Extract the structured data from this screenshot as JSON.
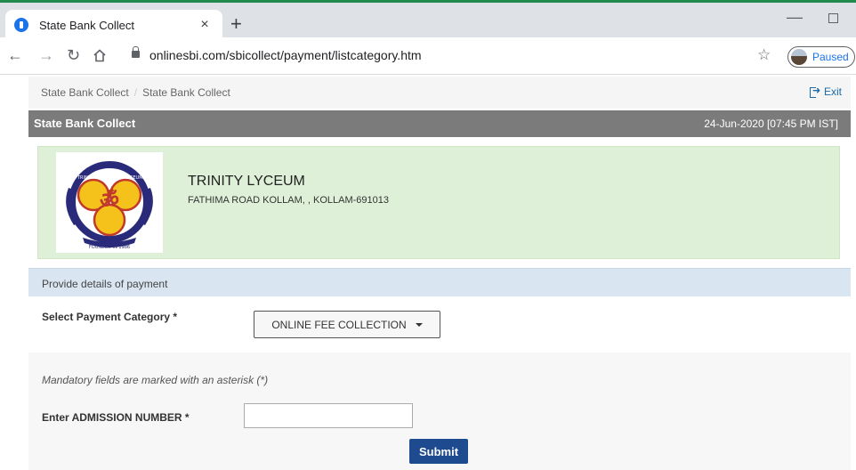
{
  "browser": {
    "tab_title": "State Bank Collect",
    "tab_close": "×",
    "new_tab": "+",
    "url": "onlinesbi.com/sbicollect/payment/listcategory.htm",
    "profile_label": "Paused",
    "window_minimize": "—"
  },
  "breadcrumb": {
    "items": [
      "State Bank Collect",
      "State Bank Collect"
    ],
    "separator": "/"
  },
  "exit_label": "Exit",
  "title_bar": {
    "title": "State Bank Collect",
    "datetime": "24-Jun-2020 [07:45 PM IST]"
  },
  "institution": {
    "name": "TRINITY LYCEUM",
    "address": "FATHIMA ROAD KOLLAM, , KOLLAM-691013",
    "logo_text": [
      "QUILON",
      "TRINITY",
      "LYCEUM",
      "FOUNDED IN 1986"
    ]
  },
  "section": {
    "header": "Provide details of payment"
  },
  "form": {
    "category_label": "Select Payment Category *",
    "category_value": "ONLINE FEE COLLECTION",
    "mandatory_note": "Mandatory fields are marked with an asterisk (*)",
    "admission_label": "Enter ADMISSION NUMBER *",
    "admission_value": "",
    "submit_label": "Submit"
  },
  "colors": {
    "title_bar": "#7b7b7b",
    "institution_panel": "#dff0d8",
    "section_header": "#d9e5f0",
    "submit_button": "#1e4b8f",
    "link": "#1a6aa8"
  }
}
